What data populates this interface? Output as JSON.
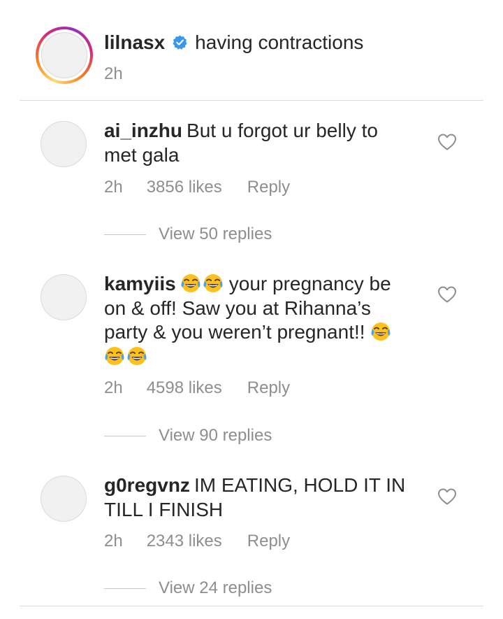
{
  "caption": {
    "username": "lilnasx",
    "text": "having contractions",
    "time": "2h"
  },
  "comments": [
    {
      "username": "ai_inzhu",
      "text": "But u forgot ur belly to met gala",
      "time": "2h",
      "likes": "3856 likes",
      "reply_label": "Reply",
      "view_replies": "View 50 replies"
    },
    {
      "username": "kamyiis",
      "text_part1": "your pregnancy be on & off! Saw you at Rihanna’s party & you weren’t pregnant!!",
      "emoji": "face-with-tears-of-joy",
      "time": "2h",
      "likes": "4598 likes",
      "reply_label": "Reply",
      "view_replies": "View 90 replies"
    },
    {
      "username": "g0regvnz",
      "text": "IM EATING, HOLD IT IN TILL I FINISH",
      "time": "2h",
      "likes": "2343 likes",
      "reply_label": "Reply",
      "view_replies": "View 24 replies"
    }
  ],
  "colors": {
    "text": "#262626",
    "secondary": "#8e8e8e",
    "verified": "#3897f0",
    "divider": "#dbdbdb"
  }
}
